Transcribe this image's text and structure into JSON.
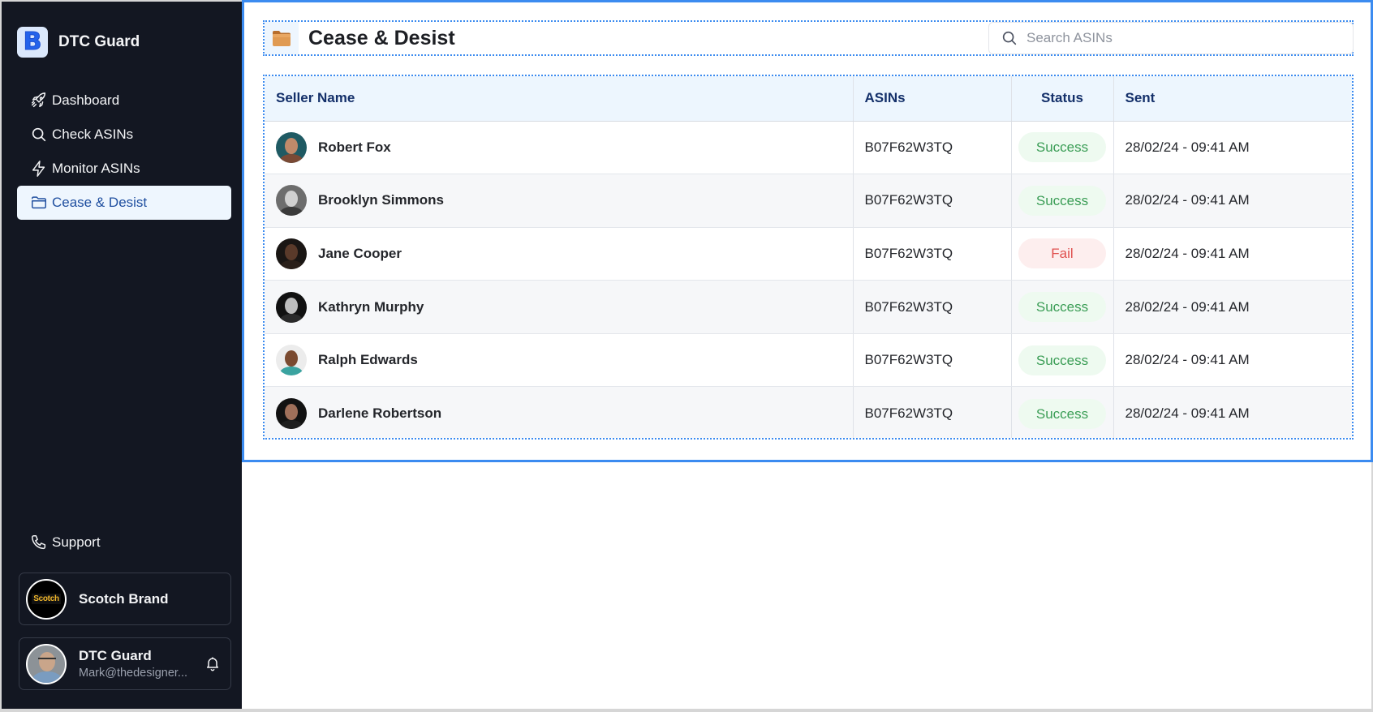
{
  "app": {
    "name": "DTC Guard",
    "logo_letter": "B"
  },
  "sidebar": {
    "items": [
      {
        "label": "Dashboard",
        "icon": "rocket-icon",
        "active": false
      },
      {
        "label": "Check ASINs",
        "icon": "search-icon",
        "active": false
      },
      {
        "label": "Monitor ASINs",
        "icon": "lightning-icon",
        "active": false
      },
      {
        "label": "Cease & Desist",
        "icon": "folder-icon",
        "active": true
      }
    ],
    "support_label": "Support",
    "brand_card": {
      "name": "Scotch Brand",
      "logo_text": "Scotch"
    },
    "user_card": {
      "name": "DTC Guard",
      "email": "Mark@thedesigner..."
    }
  },
  "header": {
    "title": "Cease & Desist",
    "icon": "folder-icon",
    "search_placeholder": "Search ASINs",
    "search_value": ""
  },
  "table": {
    "columns": [
      "Seller Name",
      "ASINs",
      "Status",
      "Sent"
    ],
    "rows": [
      {
        "seller": "Robert Fox",
        "asin": "B07F62W3TQ",
        "status": "Success",
        "sent": "28/02/24 - 09:41 AM"
      },
      {
        "seller": "Brooklyn Simmons",
        "asin": "B07F62W3TQ",
        "status": "Success",
        "sent": "28/02/24 - 09:41 AM"
      },
      {
        "seller": "Jane Cooper",
        "asin": "B07F62W3TQ",
        "status": "Fail",
        "sent": "28/02/24 - 09:41 AM"
      },
      {
        "seller": "Kathryn Murphy",
        "asin": "B07F62W3TQ",
        "status": "Success",
        "sent": "28/02/24 - 09:41 AM"
      },
      {
        "seller": "Ralph Edwards",
        "asin": "B07F62W3TQ",
        "status": "Success",
        "sent": "28/02/24 - 09:41 AM"
      },
      {
        "seller": "Darlene Robertson",
        "asin": "B07F62W3TQ",
        "status": "Success",
        "sent": "28/02/24 - 09:41 AM"
      }
    ]
  },
  "colors": {
    "accent": "#3b8bf0",
    "sidebar_bg": "#131722",
    "success": "#3a9d55",
    "fail": "#e0504e",
    "header_text": "#14306a"
  }
}
